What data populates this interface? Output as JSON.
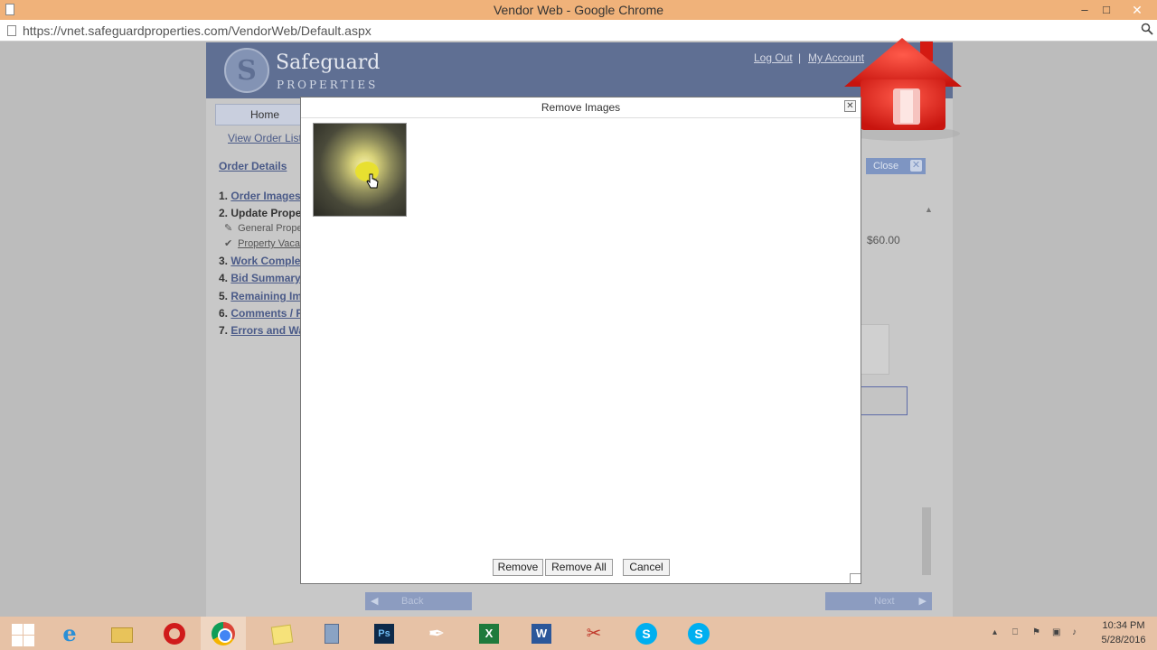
{
  "window": {
    "title": "Vendor Web - Google Chrome",
    "minimize": "–",
    "maximize": "□",
    "close": "✕"
  },
  "address_bar": {
    "url": "https://vnet.safeguardproperties.com/VendorWeb/Default.aspx",
    "zoom_icon": "magnifier-icon"
  },
  "site": {
    "logo_letter": "S",
    "logo_name": "Safeguard",
    "logo_sub": "PROPERTIES",
    "header_links": [
      "Log Out",
      "My Account"
    ],
    "header_separator": "|",
    "nav_home": "Home",
    "view_order_list": "View Order List",
    "order_details": "Order Details",
    "menu": [
      {
        "num": "1.",
        "label": "Order Images"
      },
      {
        "num": "2.",
        "label": "Update Proper"
      },
      {
        "num": "3.",
        "label": "Work Complet"
      },
      {
        "num": "4.",
        "label": "Bid Summary"
      },
      {
        "num": "5.",
        "label": "Remaining Im"
      },
      {
        "num": "6.",
        "label": "Comments / R"
      },
      {
        "num": "7.",
        "label": "Errors and Wa"
      }
    ],
    "submenu": [
      {
        "mark": "✎",
        "label": "General Proper"
      },
      {
        "mark": "✔",
        "label": "Property Vaca"
      }
    ],
    "close_button": "Close",
    "close_x": "✕",
    "price": "$60.00",
    "back_button": "Back",
    "next_button": "Next",
    "back_arrow": "◀",
    "next_arrow": "▶",
    "scroll_up": "▲"
  },
  "modal": {
    "title": "Remove Images",
    "close": "✕",
    "buttons": {
      "remove": "Remove",
      "remove_all": "Remove All",
      "cancel": "Cancel"
    }
  },
  "taskbar": {
    "icons": [
      "windows-start-icon",
      "internet-explorer-icon",
      "file-explorer-icon",
      "opera-icon",
      "chrome-icon",
      "sticky-notes-icon",
      "calculator-icon",
      "photoshop-icon",
      "pen-icon",
      "excel-icon",
      "word-icon",
      "snipping-tool-icon",
      "skype-icon",
      "skype-icon"
    ],
    "ie_glyph": "e",
    "ps_label": "Ps",
    "excel_label": "X",
    "word_label": "W",
    "skype_label": "S",
    "pen_glyph": "✒",
    "snip_glyph": "✂",
    "tray": [
      "▴",
      "⎕",
      "⚑",
      "▣",
      "♪"
    ],
    "time": "10:34 PM",
    "date": "5/28/2016"
  },
  "colors": {
    "titlebar": "#f0b27a",
    "site_header": "#5f6f93",
    "house_red": "#e32119",
    "taskbar": "#e7c2a6"
  }
}
